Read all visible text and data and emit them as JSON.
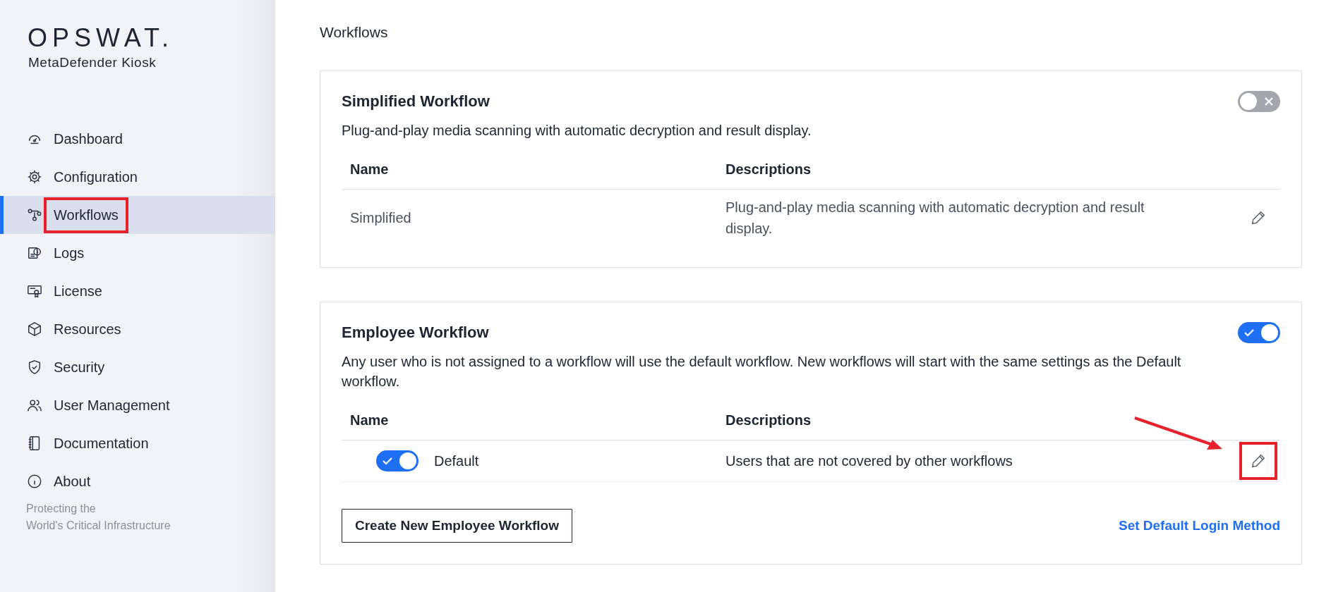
{
  "sidebar": {
    "logo": "OPSWAT.",
    "product": "MetaDefender Kiosk",
    "items": [
      {
        "label": "Dashboard",
        "selected": false,
        "highlighted": false
      },
      {
        "label": "Configuration",
        "selected": false,
        "highlighted": false
      },
      {
        "label": "Workflows",
        "selected": true,
        "highlighted": true
      },
      {
        "label": "Logs",
        "selected": false,
        "highlighted": false
      },
      {
        "label": "License",
        "selected": false,
        "highlighted": false
      },
      {
        "label": "Resources",
        "selected": false,
        "highlighted": false
      },
      {
        "label": "Security",
        "selected": false,
        "highlighted": false
      },
      {
        "label": "User Management",
        "selected": false,
        "highlighted": false
      },
      {
        "label": "Documentation",
        "selected": false,
        "highlighted": false
      },
      {
        "label": "About",
        "selected": false,
        "highlighted": false
      }
    ],
    "footer_lines": [
      "Protecting the",
      "World's Critical Infrastructure"
    ]
  },
  "page_title": "Workflows",
  "cards": [
    {
      "title": "Simplified Workflow",
      "description": "Plug-and-play media scanning with automatic decryption and result display.",
      "enabled": false,
      "columns": [
        "Name",
        "Descriptions"
      ],
      "rows": [
        {
          "name": "Simplified",
          "description": "Plug-and-play media scanning with automatic decryption and result display.",
          "edit_highlighted": false,
          "arrow": false
        }
      ]
    },
    {
      "title": "Employee Workflow",
      "description": "Any user who is not assigned to a workflow will use the default workflow. New workflows will start with the same settings as the Default workflow.",
      "enabled": true,
      "columns": [
        "Name",
        "Descriptions"
      ],
      "rows": [
        {
          "name": "Default",
          "enabled": true,
          "description": "Users that are not covered by other workflows",
          "edit_highlighted": true,
          "arrow": true
        }
      ],
      "button": "Create New Employee Workflow",
      "link": "Set Default Login Method"
    }
  ]
}
